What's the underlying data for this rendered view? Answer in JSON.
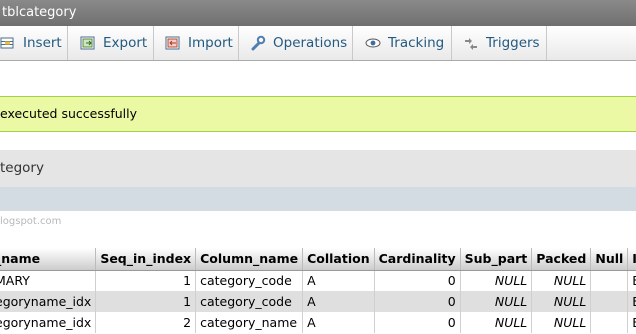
{
  "window": {
    "title": "tblcategory"
  },
  "tabs": [
    {
      "label": "Insert",
      "icon": "insert-icon"
    },
    {
      "label": "Export",
      "icon": "export-icon"
    },
    {
      "label": "Import",
      "icon": "import-icon"
    },
    {
      "label": "Operations",
      "icon": "wrench-icon"
    },
    {
      "label": "Tracking",
      "icon": "eye-icon"
    },
    {
      "label": "Triggers",
      "icon": "triggers-icon"
    }
  ],
  "message": {
    "text": "executed successfully"
  },
  "sql": {
    "text": "tegory"
  },
  "watermark": {
    "text": "logspot.com"
  },
  "table": {
    "headers": [
      "_name",
      "Seq_in_index",
      "Column_name",
      "Collation",
      "Cardinality",
      "Sub_part",
      "Packed",
      "Null",
      "Index_ty"
    ],
    "rows": [
      [
        "MARY",
        "1",
        "category_code",
        "A",
        "0",
        "NULL",
        "NULL",
        "",
        "BTREE"
      ],
      [
        "egoryname_idx",
        "1",
        "category_code",
        "A",
        "0",
        "NULL",
        "NULL",
        "",
        "BTREE"
      ],
      [
        "egoryname_idx",
        "2",
        "category_name",
        "A",
        "0",
        "NULL",
        "NULL",
        "",
        "BTREE"
      ]
    ]
  },
  "colors": {
    "tab_text": "#235a81",
    "success_bg": "#ebf8a4",
    "header_bg": "#cccccc",
    "row_alt": "#dfdfdf"
  }
}
